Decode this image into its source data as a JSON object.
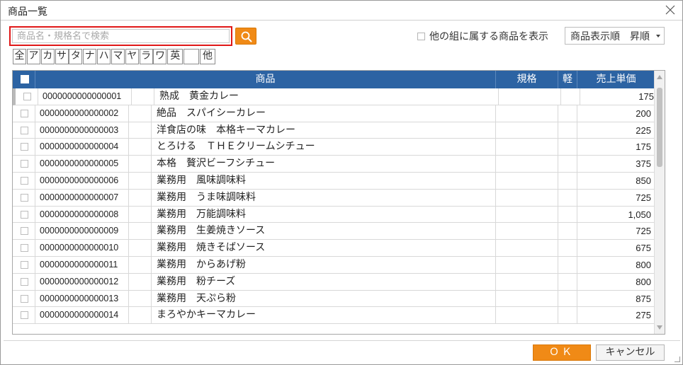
{
  "window": {
    "title": "商品一覧"
  },
  "search": {
    "placeholder": "商品名・規格名で検索",
    "value": ""
  },
  "options": {
    "other_group_label": "他の組に属する商品を表示",
    "other_group_checked": false,
    "sort_label": "商品表示順",
    "sort_order": "昇順"
  },
  "kana_filters": [
    "全",
    "ア",
    "カ",
    "サ",
    "タ",
    "ナ",
    "ハ",
    "マ",
    "ヤ",
    "ラ",
    "ワ",
    "英",
    "",
    "他"
  ],
  "table": {
    "columns": {
      "product": "商品",
      "spec": "規格",
      "light": "軽",
      "price": "売上単価"
    },
    "rows": [
      {
        "code": "0000000000000001",
        "name": "熟成　黄金カレー",
        "spec": "",
        "light": "",
        "price": "175"
      },
      {
        "code": "0000000000000002",
        "name": "絶品　スパイシーカレー",
        "spec": "",
        "light": "",
        "price": "200"
      },
      {
        "code": "0000000000000003",
        "name": "洋食店の味　本格キーマカレー",
        "spec": "",
        "light": "",
        "price": "225"
      },
      {
        "code": "0000000000000004",
        "name": "とろける　ＴＨＥクリームシチュー",
        "spec": "",
        "light": "",
        "price": "175"
      },
      {
        "code": "0000000000000005",
        "name": "本格　贅沢ビーフシチュー",
        "spec": "",
        "light": "",
        "price": "375"
      },
      {
        "code": "0000000000000006",
        "name": "業務用　風味調味料",
        "spec": "",
        "light": "",
        "price": "850"
      },
      {
        "code": "0000000000000007",
        "name": "業務用　うま味調味料",
        "spec": "",
        "light": "",
        "price": "725"
      },
      {
        "code": "0000000000000008",
        "name": "業務用　万能調味料",
        "spec": "",
        "light": "",
        "price": "1,050"
      },
      {
        "code": "0000000000000009",
        "name": "業務用　生姜焼きソース",
        "spec": "",
        "light": "",
        "price": "725"
      },
      {
        "code": "0000000000000010",
        "name": "業務用　焼きそばソース",
        "spec": "",
        "light": "",
        "price": "675"
      },
      {
        "code": "0000000000000011",
        "name": "業務用　からあげ粉",
        "spec": "",
        "light": "",
        "price": "800"
      },
      {
        "code": "0000000000000012",
        "name": "業務用　粉チーズ",
        "spec": "",
        "light": "",
        "price": "800"
      },
      {
        "code": "0000000000000013",
        "name": "業務用　天ぷら粉",
        "spec": "",
        "light": "",
        "price": "875"
      },
      {
        "code": "0000000000000014",
        "name": "まろやかキーマカレー",
        "spec": "",
        "light": "",
        "price": "275"
      }
    ]
  },
  "footer": {
    "ok_label": "ＯＫ",
    "cancel_label": "キャンセル"
  },
  "icons": {
    "close": "close-icon",
    "search": "search-icon",
    "dropdown": "chevron-down-icon"
  },
  "colors": {
    "accent": "#f08a16",
    "header": "#2c63a3",
    "highlight": "#e01818"
  }
}
